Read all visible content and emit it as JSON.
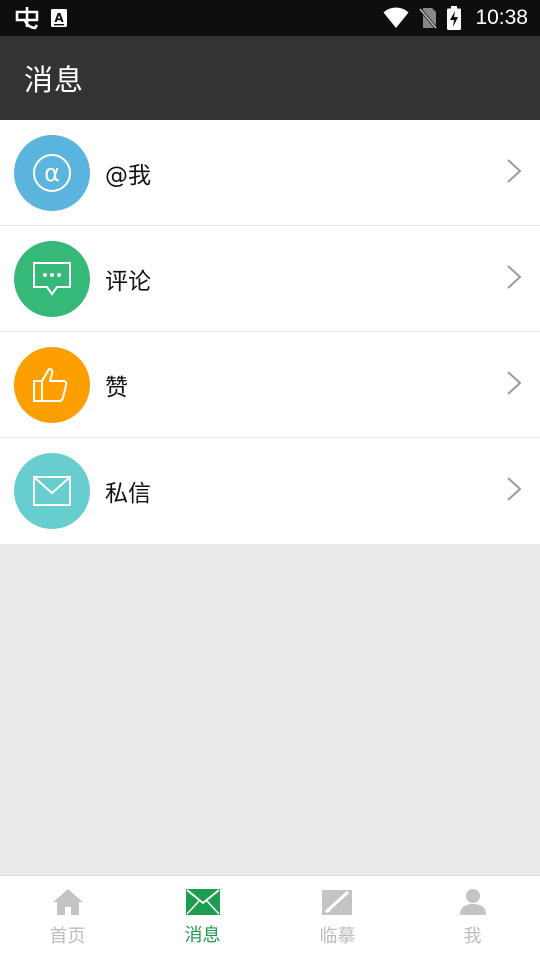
{
  "status_bar": {
    "time": "10:38",
    "left_icons": [
      "app-notification-icon",
      "keyboard-a-icon"
    ],
    "right_icons": [
      "wifi-icon",
      "no-sim-icon",
      "battery-charging-icon"
    ]
  },
  "header": {
    "title": "消息"
  },
  "messages": [
    {
      "label": "@我",
      "icon": "at-icon",
      "color": "#5ab4de"
    },
    {
      "label": "评论",
      "icon": "comment-icon",
      "color": "#36b878"
    },
    {
      "label": "赞",
      "icon": "thumbs-up-icon",
      "color": "#fe9f00"
    },
    {
      "label": "私信",
      "icon": "mail-icon",
      "color": "#67cdcf"
    }
  ],
  "bottom_nav": {
    "items": [
      {
        "label": "首页",
        "icon": "home-icon",
        "active": false
      },
      {
        "label": "消息",
        "icon": "mail-icon",
        "active": true
      },
      {
        "label": "临摹",
        "icon": "copy-pen-icon",
        "active": false
      },
      {
        "label": "我",
        "icon": "user-icon",
        "active": false
      }
    ],
    "active_color": "#1e9c4f",
    "inactive_color": "#bdbdbd"
  }
}
